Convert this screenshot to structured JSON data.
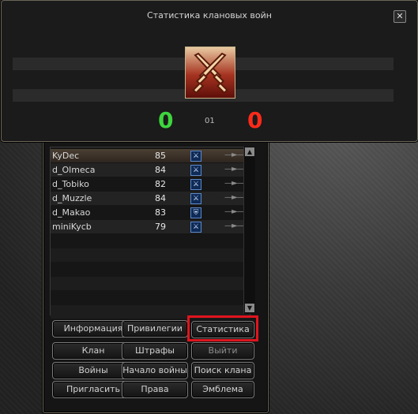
{
  "dialog": {
    "title": "Статистика клановых войн",
    "close_icon": "close-icon",
    "emblem_icon": "crossed-swords-icon",
    "score_left": "0",
    "score_right": "0",
    "round_label": "01",
    "score_colors": {
      "left": "#3dd63d",
      "right": "#ff2a1a"
    }
  },
  "members": [
    {
      "name": "KyDec",
      "level": "85",
      "class_icon": "class-icon"
    },
    {
      "name": "d_Olmeca",
      "level": "84",
      "class_icon": "class-icon"
    },
    {
      "name": "d_Tobiko",
      "level": "82",
      "class_icon": "class-icon"
    },
    {
      "name": "d_Muzzle",
      "level": "84",
      "class_icon": "class-icon"
    },
    {
      "name": "d_Makao",
      "level": "83",
      "class_icon": "shield-icon"
    },
    {
      "name": "miniKycb",
      "level": "79",
      "class_icon": "class-icon"
    }
  ],
  "buttons": {
    "info": "Информация",
    "privileges": "Привилегии",
    "statistics": "Статистика",
    "clan": "Клан",
    "fines": "Штрафы",
    "exit": "Выйти",
    "wars": "Войны",
    "start_war": "Начало войны",
    "search_clan": "Поиск клана",
    "invite": "Пригласить",
    "rights": "Права",
    "emblem": "Эмблема"
  },
  "highlight_color": "#e0141e"
}
